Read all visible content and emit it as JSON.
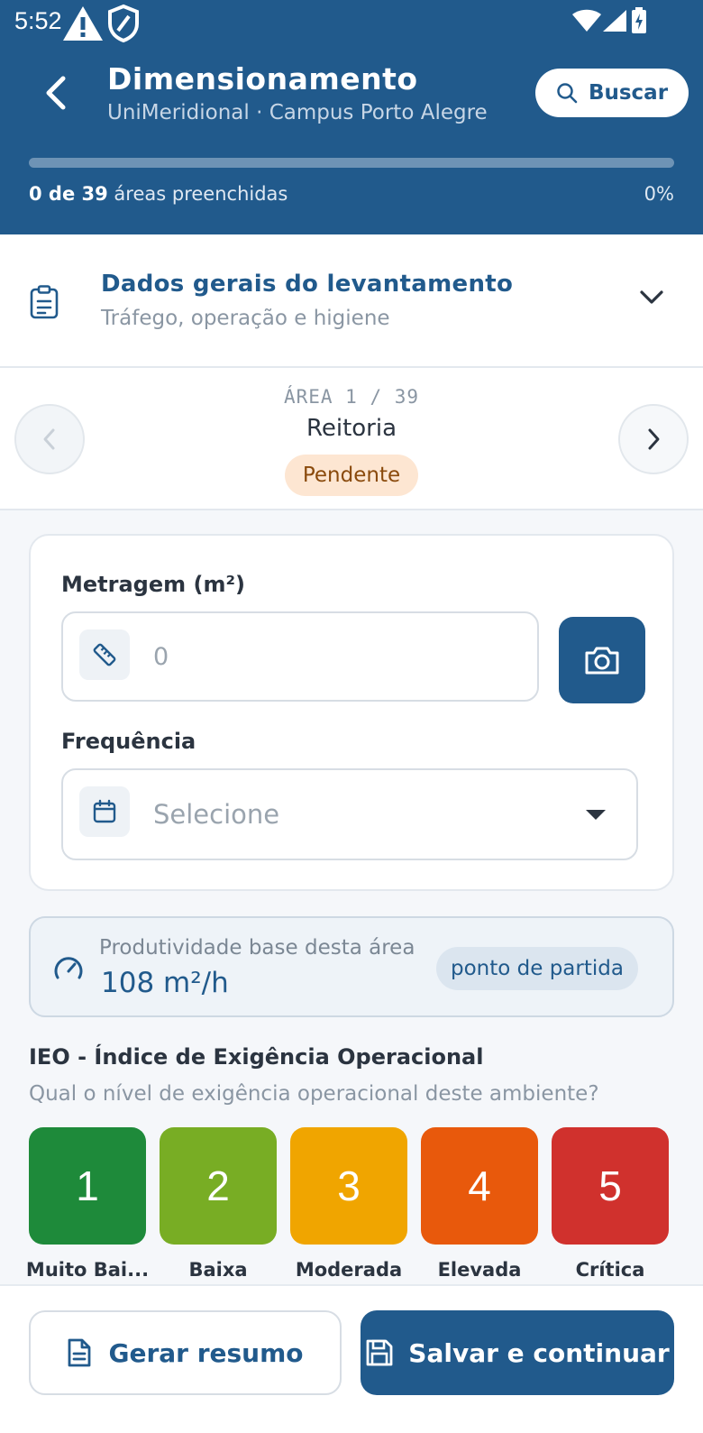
{
  "status_bar": {
    "time": "5:52"
  },
  "header": {
    "title": "Dimensionamento",
    "subtitle": "UniMeridional · Campus Porto Alegre",
    "search_label": "Buscar",
    "progress": {
      "filled": "0 de 39",
      "suffix": "áreas preenchidas",
      "percent_text": "0%",
      "fraction": 0
    }
  },
  "section": {
    "title": "Dados gerais do levantamento",
    "subtitle": "Tráfego, operação e higiene"
  },
  "area_nav": {
    "counter": "ÁREA 1 / 39",
    "name": "Reitoria",
    "status": "Pendente"
  },
  "form": {
    "area_label": "Metragem (m²)",
    "area_placeholder": "0",
    "frequency_label": "Frequência",
    "frequency_value": "Selecione"
  },
  "productivity": {
    "label": "Produtividade base desta área",
    "value": "108 m²/h",
    "badge": "ponto de partida"
  },
  "ieo": {
    "title": "IEO - Índice de Exigência Operacional",
    "question": "Qual o nível de exigência operacional deste ambiente?",
    "levels": [
      {
        "value": "1",
        "label": "Muito Bai...",
        "color": "#1e8a3a"
      },
      {
        "value": "2",
        "label": "Baixa",
        "color": "#78ad24"
      },
      {
        "value": "3",
        "label": "Moderada",
        "color": "#f0a500"
      },
      {
        "value": "4",
        "label": "Elevada",
        "color": "#e8590c"
      },
      {
        "value": "5",
        "label": "Crítica",
        "color": "#d0312d"
      }
    ]
  },
  "actions": {
    "summary_label": "Gerar resumo",
    "save_label": "Salvar e continuar"
  },
  "colors": {
    "primary": "#215a8c",
    "pending_bg": "#fde6d2"
  }
}
